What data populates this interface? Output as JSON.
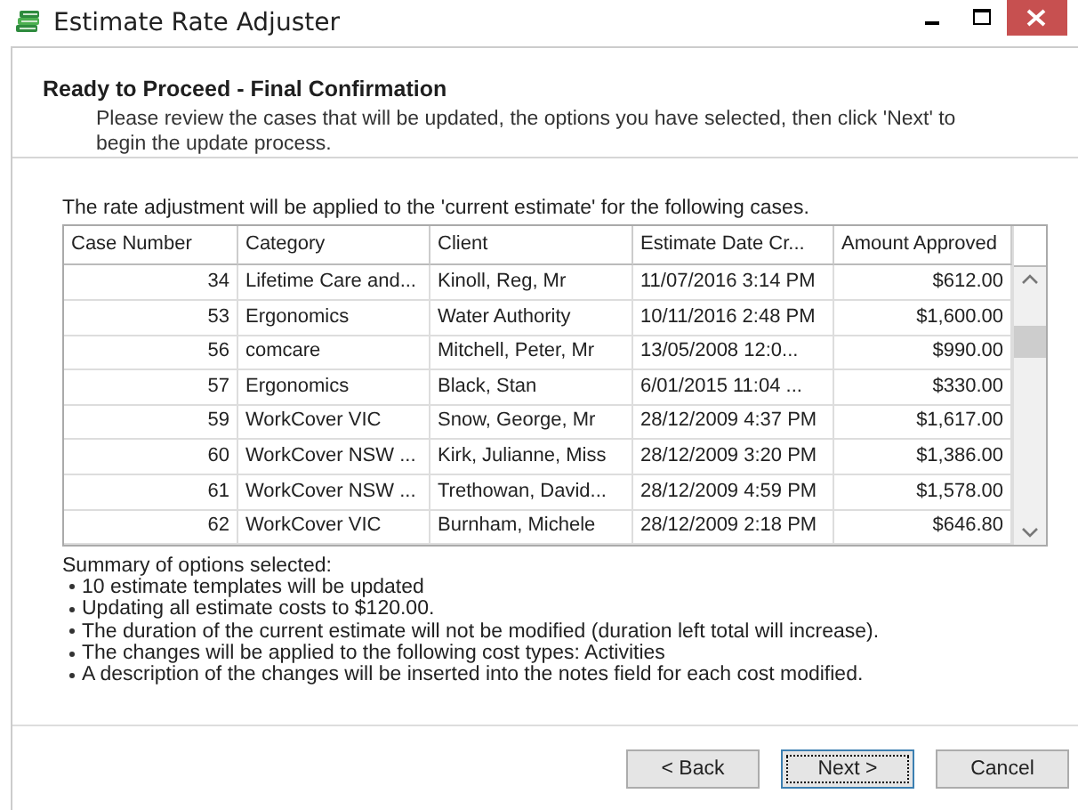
{
  "window": {
    "title": "Estimate Rate Adjuster"
  },
  "header": {
    "title": "Ready to Proceed - Final Confirmation",
    "description": "Please review the cases that will be updated, the options you have selected, then click 'Next' to begin the update process."
  },
  "intro": "The rate adjustment will be applied to the 'current estimate' for the following cases.",
  "table": {
    "columns": [
      "Case Number",
      "Category",
      "Client",
      "Estimate Date Cr...",
      "Amount Approved"
    ],
    "rows": [
      [
        "34",
        "Lifetime Care and...",
        "Kinoll, Reg, Mr",
        "11/07/2016 3:14 PM",
        "$612.00"
      ],
      [
        "53",
        "Ergonomics",
        "Water Authority",
        "10/11/2016 2:48 PM",
        "$1,600.00"
      ],
      [
        "56",
        "comcare",
        "Mitchell, Peter, Mr",
        "13/05/2008 12:0...",
        "$990.00"
      ],
      [
        "57",
        "Ergonomics",
        "Black, Stan",
        "6/01/2015 11:04 ...",
        "$330.00"
      ],
      [
        "59",
        "WorkCover VIC",
        "Snow, George, Mr",
        "28/12/2009 4:37 PM",
        "$1,617.00"
      ],
      [
        "60",
        "WorkCover NSW ...",
        "Kirk, Julianne, Miss",
        "28/12/2009 3:20 PM",
        "$1,386.00"
      ],
      [
        "61",
        "WorkCover NSW ...",
        "Trethowan, David...",
        "28/12/2009 4:59 PM",
        "$1,578.00"
      ],
      [
        "62",
        "WorkCover VIC",
        "Burnham, Michele",
        "28/12/2009 2:18 PM",
        "$646.80"
      ]
    ]
  },
  "summary": {
    "title": "Summary of options selected:",
    "items": [
      "10 estimate templates will be updated",
      "Updating all estimate costs to $120.00.",
      "The duration of the current estimate will not be modified (duration left  total will increase).",
      "The changes will be applied to the following cost types: Activities",
      "A description of the changes will be inserted into the notes field for each cost modified."
    ]
  },
  "buttons": [
    {
      "label": "< Back",
      "focused": false
    },
    {
      "label": "Next >",
      "focused": true
    },
    {
      "label": "Cancel",
      "focused": false
    }
  ]
}
